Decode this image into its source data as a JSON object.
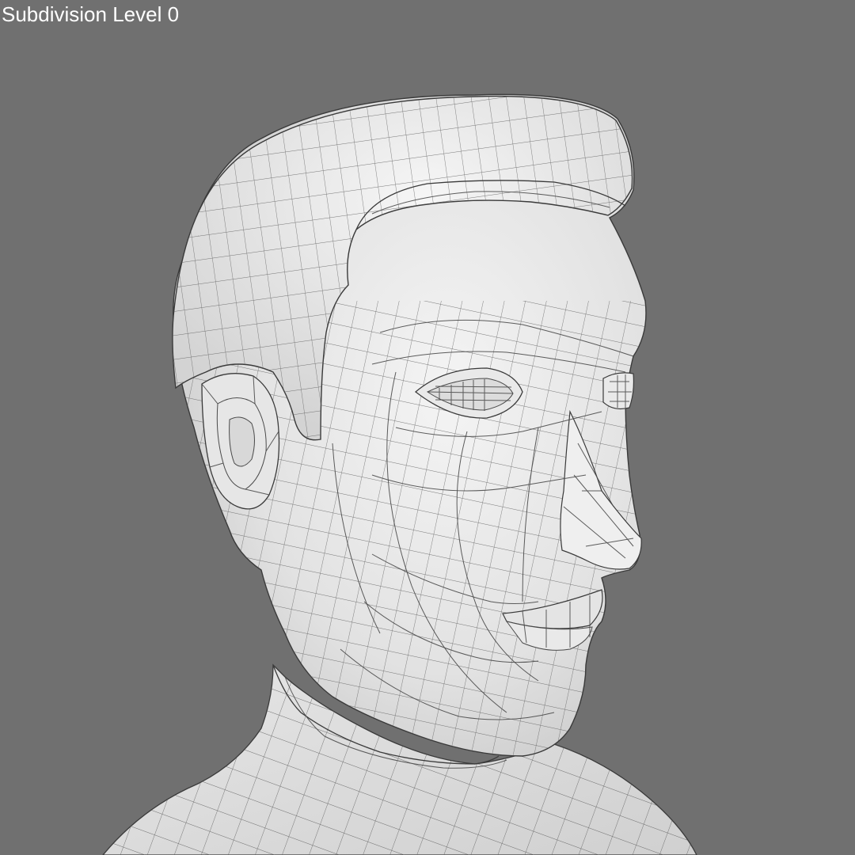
{
  "viewport": {
    "overlay_label": "Subdivision Level 0",
    "background_color": "#707070",
    "mesh_color": "#eeeeee",
    "wire_color": "#4a4a4a"
  }
}
